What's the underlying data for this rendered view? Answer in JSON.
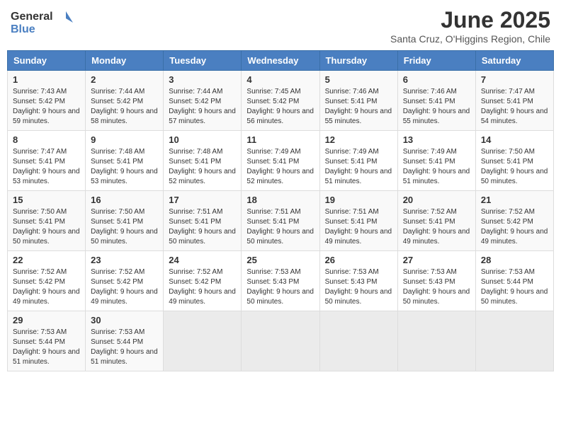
{
  "logo": {
    "line1": "General",
    "line2": "Blue"
  },
  "title": "June 2025",
  "subtitle": "Santa Cruz, O'Higgins Region, Chile",
  "weekdays": [
    "Sunday",
    "Monday",
    "Tuesday",
    "Wednesday",
    "Thursday",
    "Friday",
    "Saturday"
  ],
  "weeks": [
    [
      {
        "day": "1",
        "sunrise": "7:43 AM",
        "sunset": "5:42 PM",
        "daylight": "9 hours and 59 minutes."
      },
      {
        "day": "2",
        "sunrise": "7:44 AM",
        "sunset": "5:42 PM",
        "daylight": "9 hours and 58 minutes."
      },
      {
        "day": "3",
        "sunrise": "7:44 AM",
        "sunset": "5:42 PM",
        "daylight": "9 hours and 57 minutes."
      },
      {
        "day": "4",
        "sunrise": "7:45 AM",
        "sunset": "5:42 PM",
        "daylight": "9 hours and 56 minutes."
      },
      {
        "day": "5",
        "sunrise": "7:46 AM",
        "sunset": "5:41 PM",
        "daylight": "9 hours and 55 minutes."
      },
      {
        "day": "6",
        "sunrise": "7:46 AM",
        "sunset": "5:41 PM",
        "daylight": "9 hours and 55 minutes."
      },
      {
        "day": "7",
        "sunrise": "7:47 AM",
        "sunset": "5:41 PM",
        "daylight": "9 hours and 54 minutes."
      }
    ],
    [
      {
        "day": "8",
        "sunrise": "7:47 AM",
        "sunset": "5:41 PM",
        "daylight": "9 hours and 53 minutes."
      },
      {
        "day": "9",
        "sunrise": "7:48 AM",
        "sunset": "5:41 PM",
        "daylight": "9 hours and 53 minutes."
      },
      {
        "day": "10",
        "sunrise": "7:48 AM",
        "sunset": "5:41 PM",
        "daylight": "9 hours and 52 minutes."
      },
      {
        "day": "11",
        "sunrise": "7:49 AM",
        "sunset": "5:41 PM",
        "daylight": "9 hours and 52 minutes."
      },
      {
        "day": "12",
        "sunrise": "7:49 AM",
        "sunset": "5:41 PM",
        "daylight": "9 hours and 51 minutes."
      },
      {
        "day": "13",
        "sunrise": "7:49 AM",
        "sunset": "5:41 PM",
        "daylight": "9 hours and 51 minutes."
      },
      {
        "day": "14",
        "sunrise": "7:50 AM",
        "sunset": "5:41 PM",
        "daylight": "9 hours and 50 minutes."
      }
    ],
    [
      {
        "day": "15",
        "sunrise": "7:50 AM",
        "sunset": "5:41 PM",
        "daylight": "9 hours and 50 minutes."
      },
      {
        "day": "16",
        "sunrise": "7:50 AM",
        "sunset": "5:41 PM",
        "daylight": "9 hours and 50 minutes."
      },
      {
        "day": "17",
        "sunrise": "7:51 AM",
        "sunset": "5:41 PM",
        "daylight": "9 hours and 50 minutes."
      },
      {
        "day": "18",
        "sunrise": "7:51 AM",
        "sunset": "5:41 PM",
        "daylight": "9 hours and 50 minutes."
      },
      {
        "day": "19",
        "sunrise": "7:51 AM",
        "sunset": "5:41 PM",
        "daylight": "9 hours and 49 minutes."
      },
      {
        "day": "20",
        "sunrise": "7:52 AM",
        "sunset": "5:41 PM",
        "daylight": "9 hours and 49 minutes."
      },
      {
        "day": "21",
        "sunrise": "7:52 AM",
        "sunset": "5:42 PM",
        "daylight": "9 hours and 49 minutes."
      }
    ],
    [
      {
        "day": "22",
        "sunrise": "7:52 AM",
        "sunset": "5:42 PM",
        "daylight": "9 hours and 49 minutes."
      },
      {
        "day": "23",
        "sunrise": "7:52 AM",
        "sunset": "5:42 PM",
        "daylight": "9 hours and 49 minutes."
      },
      {
        "day": "24",
        "sunrise": "7:52 AM",
        "sunset": "5:42 PM",
        "daylight": "9 hours and 49 minutes."
      },
      {
        "day": "25",
        "sunrise": "7:53 AM",
        "sunset": "5:43 PM",
        "daylight": "9 hours and 50 minutes."
      },
      {
        "day": "26",
        "sunrise": "7:53 AM",
        "sunset": "5:43 PM",
        "daylight": "9 hours and 50 minutes."
      },
      {
        "day": "27",
        "sunrise": "7:53 AM",
        "sunset": "5:43 PM",
        "daylight": "9 hours and 50 minutes."
      },
      {
        "day": "28",
        "sunrise": "7:53 AM",
        "sunset": "5:44 PM",
        "daylight": "9 hours and 50 minutes."
      }
    ],
    [
      {
        "day": "29",
        "sunrise": "7:53 AM",
        "sunset": "5:44 PM",
        "daylight": "9 hours and 51 minutes."
      },
      {
        "day": "30",
        "sunrise": "7:53 AM",
        "sunset": "5:44 PM",
        "daylight": "9 hours and 51 minutes."
      },
      null,
      null,
      null,
      null,
      null
    ]
  ]
}
